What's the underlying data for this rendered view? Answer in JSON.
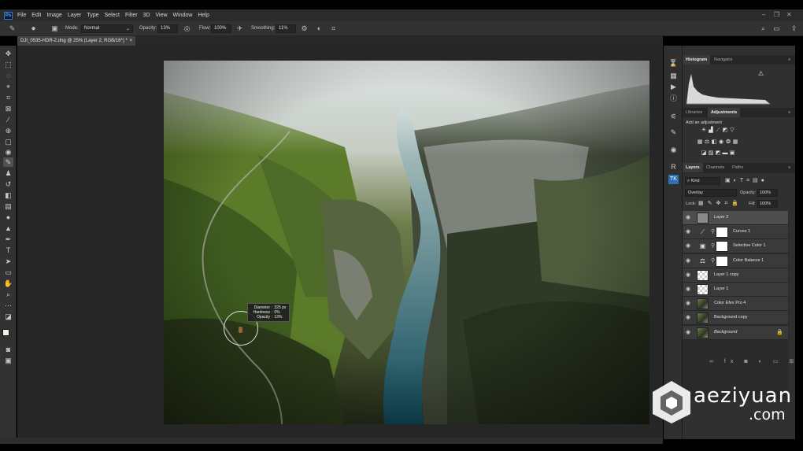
{
  "app": {
    "name": "Ps",
    "menu": [
      "File",
      "Edit",
      "Image",
      "Layer",
      "Type",
      "Select",
      "Filter",
      "3D",
      "View",
      "Window",
      "Help"
    ]
  },
  "options": {
    "mode_label": "Mode:",
    "mode_value": "Normal",
    "opacity_label": "Opacity:",
    "opacity_value": "13%",
    "flow_label": "Flow:",
    "flow_value": "100%",
    "smoothing_label": "Smoothing:",
    "smoothing_value": "11%"
  },
  "document": {
    "tab_title": "DJI_0535-HDR-2.dng @ 25% (Layer 2, RGB/16*) *"
  },
  "brush_tooltip": {
    "rows": [
      {
        "label": "Diameter",
        "value": "325 px"
      },
      {
        "label": "Hardness",
        "value": "0%"
      },
      {
        "label": "Opacity",
        "value": "13%"
      }
    ]
  },
  "panels": {
    "top_tabs": [
      "Histogram",
      "Navigator"
    ],
    "mid_tabs": [
      "Libraries",
      "Adjustments"
    ],
    "add_adjustment": "Add an adjustment",
    "layer_tabs": [
      "Layers",
      "Channels",
      "Paths"
    ],
    "filter_kind": "Kind",
    "blend_mode": "Overlay",
    "opacity_label": "Opacity:",
    "opacity_value": "100%",
    "lock_label": "Lock:",
    "fill_label": "Fill:",
    "fill_value": "100%"
  },
  "layers": [
    {
      "name": "Layer 2",
      "type": "gray",
      "selected": true
    },
    {
      "name": "Curves 1",
      "type": "adjust",
      "icon": "curves-icon"
    },
    {
      "name": "Selective Color 1",
      "type": "adjust",
      "icon": "selective-color-icon"
    },
    {
      "name": "Color Balance 1",
      "type": "adjust",
      "icon": "color-balance-icon"
    },
    {
      "name": "Layer 1 copy",
      "type": "checker"
    },
    {
      "name": "Layer 1",
      "type": "checker"
    },
    {
      "name": "Color Efex Pro 4",
      "type": "photo"
    },
    {
      "name": "Background copy",
      "type": "photo"
    },
    {
      "name": "Background",
      "type": "photo",
      "italic": true,
      "locked": true
    }
  ],
  "watermark": {
    "line1": "aeziyuan",
    "line2": ".com"
  },
  "colors": {
    "accent": "#2f7bd1",
    "ui_bg": "#323232"
  }
}
